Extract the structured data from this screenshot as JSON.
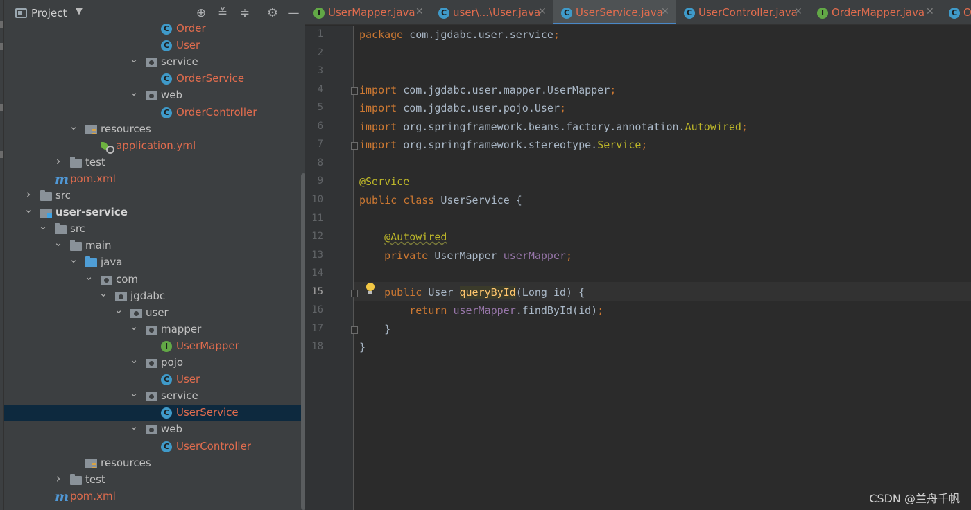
{
  "panel": {
    "title": "Project",
    "caret": "▼",
    "tools": [
      "locate-icon",
      "expand-all-icon",
      "collapse-all-icon",
      "gear-icon",
      "minimize-icon"
    ]
  },
  "tree": [
    {
      "label": "Order",
      "icon": "class",
      "color": "modified",
      "indent": 226,
      "arrow": ""
    },
    {
      "label": "User",
      "icon": "class",
      "color": "modified",
      "indent": 226,
      "arrow": ""
    },
    {
      "label": "service",
      "icon": "package",
      "color": "default",
      "indent": 204,
      "arrow": "v"
    },
    {
      "label": "OrderService",
      "icon": "class",
      "color": "modified",
      "indent": 226,
      "arrow": ""
    },
    {
      "label": "web",
      "icon": "package",
      "color": "default",
      "indent": 204,
      "arrow": "v"
    },
    {
      "label": "OrderController",
      "icon": "class",
      "color": "modified",
      "indent": 226,
      "arrow": ""
    },
    {
      "label": "resources",
      "icon": "resources",
      "color": "default",
      "indent": 117,
      "arrow": "v"
    },
    {
      "label": "application.yml",
      "icon": "yml",
      "color": "modified",
      "indent": 139,
      "arrow": ""
    },
    {
      "label": "test",
      "icon": "folder",
      "color": "default",
      "indent": 95,
      "arrow": ">"
    },
    {
      "label": "pom.xml",
      "icon": "maven",
      "color": "modified",
      "indent": 73,
      "arrow": ""
    },
    {
      "label": "src",
      "icon": "folder",
      "color": "default",
      "indent": 52,
      "arrow": ">"
    },
    {
      "label": "user-service",
      "icon": "module",
      "color": "bold",
      "indent": 52,
      "arrow": "v"
    },
    {
      "label": "src",
      "icon": "folder",
      "color": "default",
      "indent": 73,
      "arrow": "v"
    },
    {
      "label": "main",
      "icon": "folder",
      "color": "default",
      "indent": 95,
      "arrow": "v"
    },
    {
      "label": "java",
      "icon": "source-folder",
      "color": "default",
      "indent": 117,
      "arrow": "v"
    },
    {
      "label": "com",
      "icon": "package",
      "color": "default",
      "indent": 139,
      "arrow": "v"
    },
    {
      "label": "jgdabc",
      "icon": "package",
      "color": "default",
      "indent": 160,
      "arrow": "v"
    },
    {
      "label": "user",
      "icon": "package",
      "color": "default",
      "indent": 182,
      "arrow": "v"
    },
    {
      "label": "mapper",
      "icon": "package",
      "color": "default",
      "indent": 204,
      "arrow": "v"
    },
    {
      "label": "UserMapper",
      "icon": "interface",
      "color": "modified",
      "indent": 226,
      "arrow": ""
    },
    {
      "label": "pojo",
      "icon": "package",
      "color": "default",
      "indent": 204,
      "arrow": "v"
    },
    {
      "label": "User",
      "icon": "class",
      "color": "modified",
      "indent": 226,
      "arrow": ""
    },
    {
      "label": "service",
      "icon": "package",
      "color": "default",
      "indent": 204,
      "arrow": "v"
    },
    {
      "label": "UserService",
      "icon": "class",
      "color": "modified",
      "indent": 226,
      "arrow": "",
      "selected": true
    },
    {
      "label": "web",
      "icon": "package",
      "color": "default",
      "indent": 204,
      "arrow": "v"
    },
    {
      "label": "UserController",
      "icon": "class",
      "color": "modified",
      "indent": 226,
      "arrow": ""
    },
    {
      "label": "resources",
      "icon": "resources",
      "color": "default",
      "indent": 117,
      "arrow": ""
    },
    {
      "label": "test",
      "icon": "folder",
      "color": "default",
      "indent": 95,
      "arrow": ">"
    },
    {
      "label": "pom.xml",
      "icon": "maven",
      "color": "modified",
      "indent": 73,
      "arrow": ""
    }
  ],
  "tabs": [
    {
      "label": "UserMapper.java",
      "icon": "interface",
      "active": false
    },
    {
      "label": "user\\...\\User.java",
      "icon": "class",
      "active": false
    },
    {
      "label": "UserService.java",
      "icon": "class",
      "active": true
    },
    {
      "label": "UserController.java",
      "icon": "class",
      "active": false
    },
    {
      "label": "OrderMapper.java",
      "icon": "interface",
      "active": false
    },
    {
      "label": "O",
      "icon": "class",
      "active": false
    }
  ],
  "editor": {
    "current_line": 15,
    "line_count": 18,
    "lines": [
      [
        [
          "kw",
          "package "
        ],
        [
          "p",
          "com.jgdabc.user.service"
        ],
        [
          "kw",
          ";"
        ]
      ],
      [],
      [],
      [
        [
          "kw",
          "import "
        ],
        [
          "p",
          "com.jgdabc.user.mapper.UserMapper"
        ],
        [
          "kw",
          ";"
        ]
      ],
      [
        [
          "kw",
          "import "
        ],
        [
          "p",
          "com.jgdabc.user.pojo.User"
        ],
        [
          "kw",
          ";"
        ]
      ],
      [
        [
          "kw",
          "import "
        ],
        [
          "p",
          "org.springframework.beans.factory.annotation."
        ],
        [
          "ann",
          "Autowired"
        ],
        [
          "kw",
          ";"
        ]
      ],
      [
        [
          "kw",
          "import "
        ],
        [
          "p",
          "org.springframework.stereotype."
        ],
        [
          "ann",
          "Service"
        ],
        [
          "kw",
          ";"
        ]
      ],
      [],
      [
        [
          "ann",
          "@Service"
        ]
      ],
      [
        [
          "kw",
          "public class "
        ],
        [
          "p",
          "UserService {"
        ]
      ],
      [],
      [
        [
          "p",
          "    "
        ],
        [
          "annw",
          "@Autowired"
        ]
      ],
      [
        [
          "p",
          "    "
        ],
        [
          "kw",
          "private "
        ],
        [
          "p",
          "UserMapper "
        ],
        [
          "fld",
          "userMapper"
        ],
        [
          "kw",
          ";"
        ]
      ],
      [],
      [
        [
          "p",
          "    "
        ],
        [
          "kw",
          "public "
        ],
        [
          "p",
          "User "
        ],
        [
          "mthh",
          "queryById"
        ],
        [
          "p",
          "(Long id) {"
        ]
      ],
      [
        [
          "p",
          "        "
        ],
        [
          "kw",
          "return "
        ],
        [
          "fld",
          "userMapper"
        ],
        [
          "p",
          ".findById(id)"
        ],
        [
          "kw",
          ";"
        ]
      ],
      [
        [
          "p",
          "    }"
        ]
      ],
      [
        [
          "p",
          "}"
        ]
      ]
    ]
  },
  "watermark": "CSDN @兰舟千帆"
}
